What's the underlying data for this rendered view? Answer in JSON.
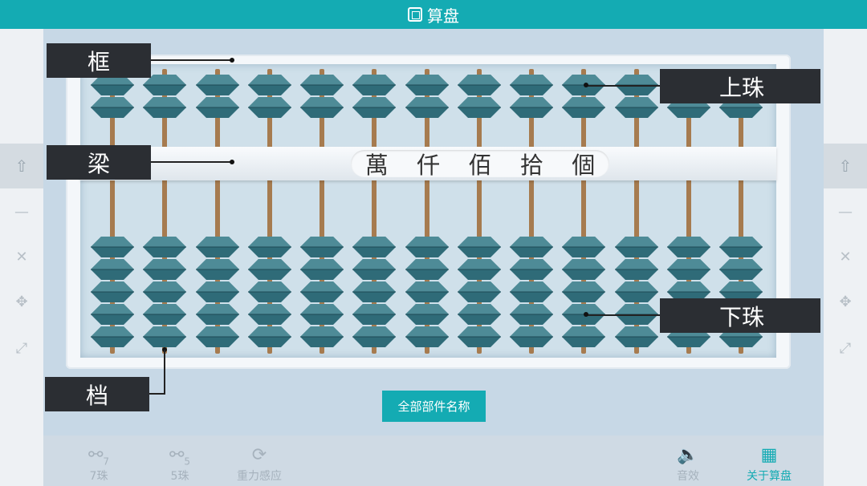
{
  "title": "算盘",
  "labels": {
    "frame": "框",
    "beam": "梁",
    "upper_bead": "上珠",
    "lower_bead": "下珠",
    "rod": "档"
  },
  "place_values": [
    "萬",
    "仟",
    "佰",
    "拾",
    "個"
  ],
  "all_names_button": "全部部件名称",
  "toolbar": {
    "seven_bead": "7珠",
    "seven_num": "7",
    "five_bead": "5珠",
    "five_num": "5",
    "gravity": "重力感应",
    "sound": "音效",
    "about": "关于算盘"
  },
  "side_icons": [
    "share-icon",
    "minimize-icon",
    "close-icon",
    "move-icon",
    "fullscreen-icon"
  ],
  "rod_count": 13,
  "upper_beads_per_rod": 2,
  "lower_beads_per_rod": 5,
  "colors": {
    "accent": "#14abb3",
    "bead": "#2f6b78",
    "rod": "#a67b4f",
    "label_bg": "#2b2e33"
  }
}
